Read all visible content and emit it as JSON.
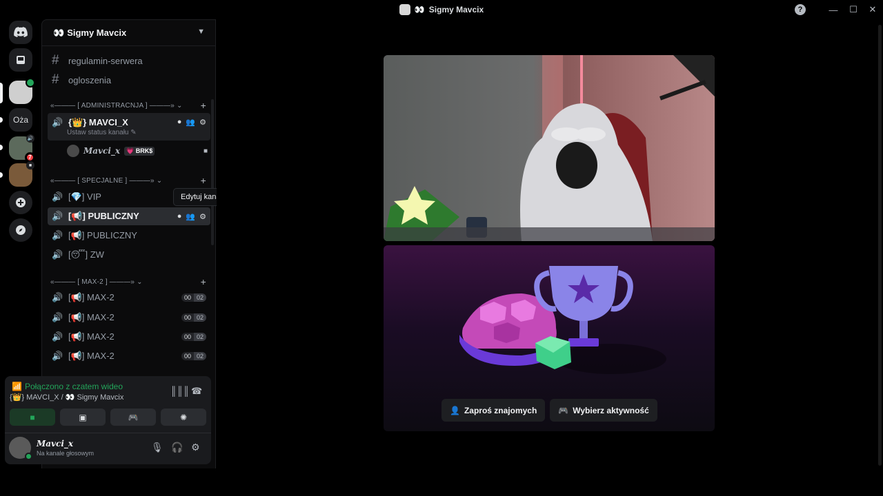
{
  "window": {
    "title": "Sigmy Mavcix",
    "title_emoji": "👀",
    "help": "?",
    "minimize": "—",
    "maximize": "☐",
    "close": "✕"
  },
  "rail": {
    "text_server": "Oża",
    "badge_count": "7"
  },
  "server": {
    "name": "Sigmy Mavcix",
    "emoji": "👀"
  },
  "channels": {
    "text": [
      "regulamin-serwera",
      "ogloszenia"
    ],
    "categories": [
      "«——— [ ADMINISTRACNJA ] ———» ⌄",
      "«——— [ SPECJALNE ] ———» ⌄",
      "«——— [ MAX-2 ] ———» ⌄"
    ],
    "admin_channel": "{👑} MAVCI_X",
    "admin_status": "Ustaw status kanału ✎",
    "voice_user": "𝑴𝒂𝒗𝒄𝒊_𝒙",
    "voice_user_tag": "💗 BRK$",
    "special": [
      "[💎] VIP",
      "[📢] PUBLICZNY",
      "[📢] PUBLICZNY",
      "[😴] ZW"
    ],
    "max2": [
      "[📢] MAX-2",
      "[📢] MAX-2",
      "[📢] MAX-2",
      "[📢] MAX-2"
    ],
    "count_a": "00",
    "count_b": "02"
  },
  "tooltip": "Edytuj kanał",
  "voice_panel": {
    "status": "Połączono z czatem wideo",
    "location": "{👑} MAVCI_X / 👀 Sigmy Mavcix"
  },
  "user": {
    "name": "𝑴𝒂𝒗𝒄𝒊_𝒙",
    "status": "Na kanale głosowym"
  },
  "stage": {
    "invite_button": "Zaproś znajomych",
    "activity_button": "Wybierz aktywność"
  },
  "colors": {
    "accent_green": "#23a55a",
    "alert_red": "#f23f43",
    "sidebar_bg": "#0b0b0c"
  }
}
